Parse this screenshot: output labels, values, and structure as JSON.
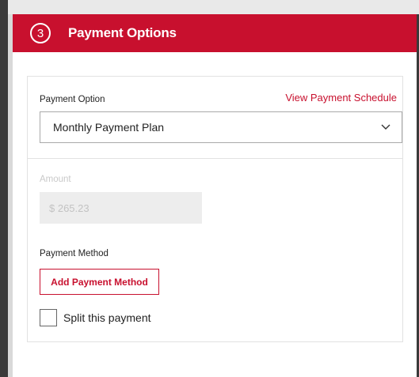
{
  "header": {
    "step_number": "3",
    "title": "Payment Options",
    "background_color": "#c8102e"
  },
  "payment_option": {
    "label": "Payment Option",
    "link_text": "View Payment Schedule",
    "selected_value": "Monthly Payment Plan"
  },
  "amount": {
    "label": "Amount",
    "value": "$ 265.23"
  },
  "payment_method": {
    "label": "Payment Method",
    "add_button_label": "Add Payment Method"
  },
  "split_payment": {
    "label": "Split this payment",
    "checked": false
  },
  "colors": {
    "accent": "#c8102e",
    "disabled_text": "#c3c3c3",
    "disabled_bg": "#ededed"
  }
}
